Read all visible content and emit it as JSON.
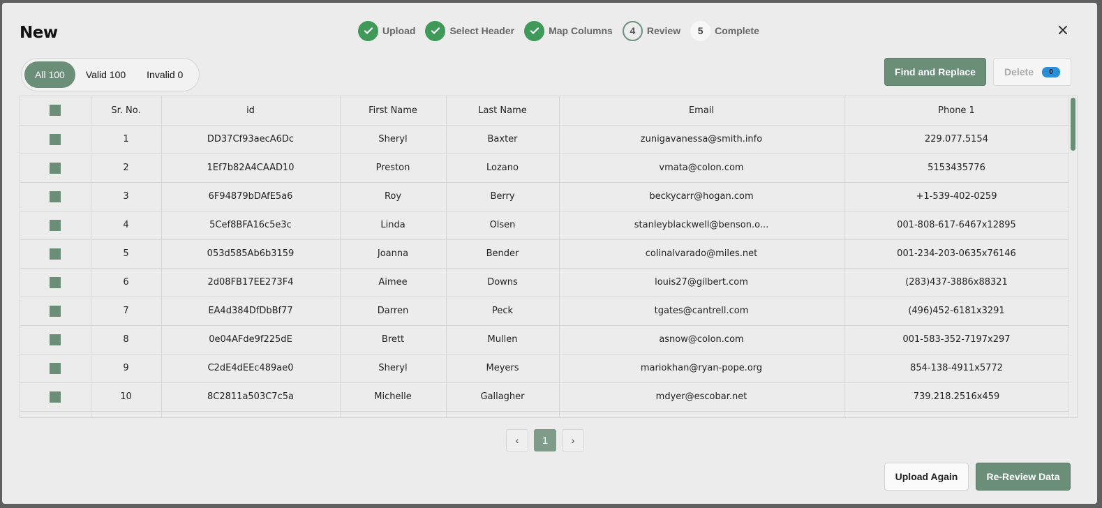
{
  "modal": {
    "title": "New",
    "close_glyph": "×"
  },
  "stepper": {
    "steps": [
      {
        "label": "Upload",
        "state": "done",
        "number": ""
      },
      {
        "label": "Select Header",
        "state": "done",
        "number": ""
      },
      {
        "label": "Map Columns",
        "state": "done",
        "number": ""
      },
      {
        "label": "Review",
        "state": "current",
        "number": "4"
      },
      {
        "label": "Complete",
        "state": "todo",
        "number": "5"
      }
    ]
  },
  "filters": [
    {
      "label": "All 100",
      "active": true
    },
    {
      "label": "Valid 100",
      "active": false
    },
    {
      "label": "Invalid 0",
      "active": false
    }
  ],
  "toolbar": {
    "find_replace_label": "Find and Replace",
    "delete_label": "Delete",
    "delete_count": "0"
  },
  "table": {
    "columns": [
      "",
      "Sr. No.",
      "id",
      "First Name",
      "Last Name",
      "Email",
      "Phone 1"
    ],
    "rows": [
      [
        "1",
        "DD37Cf93aecA6Dc",
        "Sheryl",
        "Baxter",
        "zunigavanessa@smith.info",
        "229.077.5154"
      ],
      [
        "2",
        "1Ef7b82A4CAAD10",
        "Preston",
        "Lozano",
        "vmata@colon.com",
        "5153435776"
      ],
      [
        "3",
        "6F94879bDAfE5a6",
        "Roy",
        "Berry",
        "beckycarr@hogan.com",
        "+1-539-402-0259"
      ],
      [
        "4",
        "5Cef8BFA16c5e3c",
        "Linda",
        "Olsen",
        "stanleyblackwell@benson.o...",
        "001-808-617-6467x12895"
      ],
      [
        "5",
        "053d585Ab6b3159",
        "Joanna",
        "Bender",
        "colinalvarado@miles.net",
        "001-234-203-0635x76146"
      ],
      [
        "6",
        "2d08FB17EE273F4",
        "Aimee",
        "Downs",
        "louis27@gilbert.com",
        "(283)437-3886x88321"
      ],
      [
        "7",
        "EA4d384DfDbBf77",
        "Darren",
        "Peck",
        "tgates@cantrell.com",
        "(496)452-6181x3291"
      ],
      [
        "8",
        "0e04AFde9f225dE",
        "Brett",
        "Mullen",
        "asnow@colon.com",
        "001-583-352-7197x297"
      ],
      [
        "9",
        "C2dE4dEEc489ae0",
        "Sheryl",
        "Meyers",
        "mariokhan@ryan-pope.org",
        "854-138-4911x5772"
      ],
      [
        "10",
        "8C2811a503C7c5a",
        "Michelle",
        "Gallagher",
        "mdyer@escobar.net",
        "739.218.2516x459"
      ]
    ]
  },
  "pagination": {
    "prev_glyph": "‹",
    "current_page": "1",
    "next_glyph": "›"
  },
  "footer": {
    "upload_again_label": "Upload Again",
    "rereview_label": "Re-Review Data"
  },
  "colors": {
    "accent": "#6b8e79",
    "step_done": "#3f9a5a",
    "badge": "#2b8fd6"
  }
}
